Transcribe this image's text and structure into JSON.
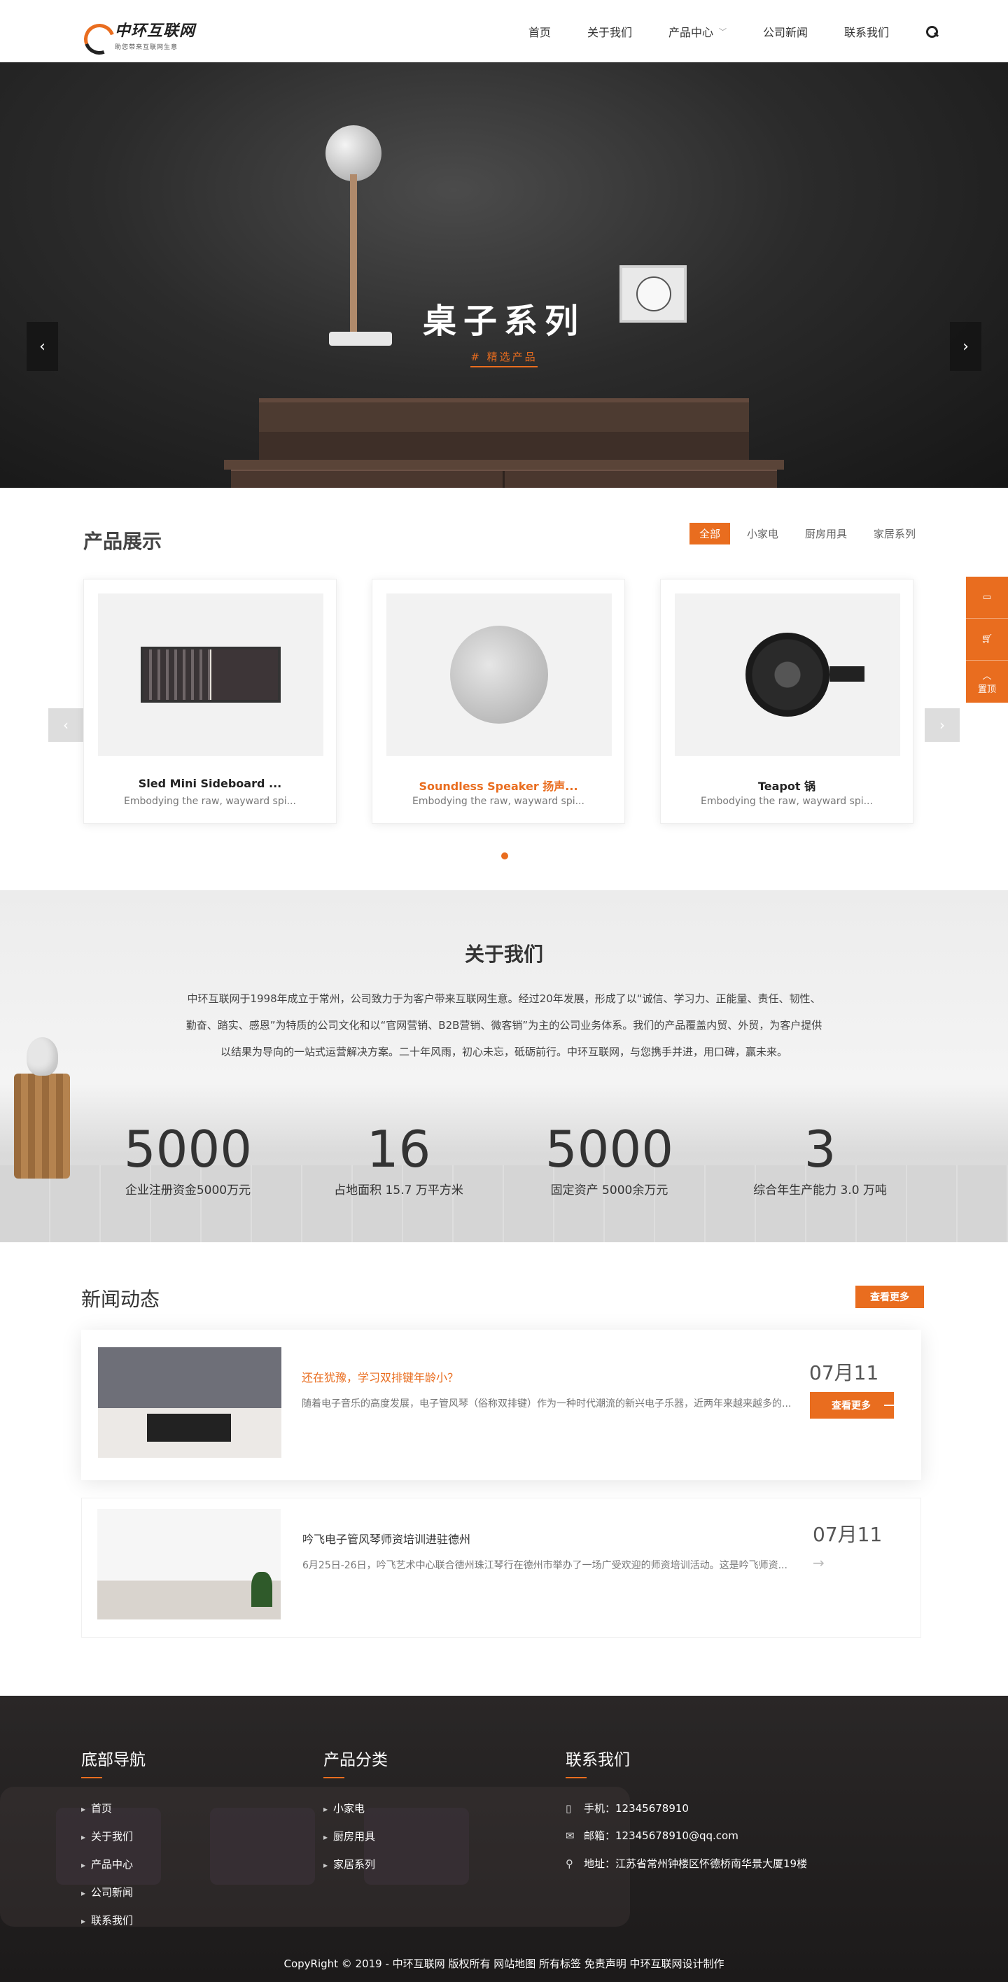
{
  "brand": {
    "name": "中环互联网",
    "slogan": "助您带来互联网生意",
    "accent_color": "#e96d1f"
  },
  "nav": {
    "items": [
      {
        "label": "首页"
      },
      {
        "label": "关于我们"
      },
      {
        "label": "产品中心"
      },
      {
        "label": "公司新闻"
      },
      {
        "label": "联系我们"
      }
    ],
    "search_icon": "search-icon",
    "dropdown_icon": "chevron-down-icon"
  },
  "banner": {
    "title": "桌子系列",
    "subtitle": "# 精选产品",
    "prev_icon": "chevron-left-icon",
    "next_icon": "chevron-right-icon"
  },
  "products": {
    "title": "产品展示",
    "tabs": [
      {
        "label": "全部",
        "active": true
      },
      {
        "label": "小家电",
        "active": false
      },
      {
        "label": "厨房用具",
        "active": false
      },
      {
        "label": "家居系列",
        "active": false
      }
    ],
    "items": [
      {
        "title": "Sled Mini Sideboard ...",
        "desc": "Embodying the raw, wayward spi..."
      },
      {
        "title": "Soundless Speaker 扬声...",
        "desc": "Embodying the raw, wayward spi..."
      },
      {
        "title": "Teapot 锅",
        "desc": "Embodying the raw, wayward spi..."
      }
    ]
  },
  "about": {
    "title": "关于我们",
    "intro": "中环互联网于1998年成立于常州，公司致力于为客户带来互联网生意。经过20年发展，形成了以“诚信、学习力、正能量、责任、韧性、勤奋、踏实、感恩”为特质的公司文化和以“官网营销、B2B营销、微客销”为主的公司业务体系。我们的产品覆盖内贸、外贸，为客户提供以结果为导向的一站式运营解决方案。二十年风雨，初心未忘，砥砺前行。中环互联网，与您携手并进，用口碑，赢未来。",
    "stats": [
      {
        "num": "5000",
        "label": "企业注册资金5000万元"
      },
      {
        "num": "16",
        "label": "占地面积 15.7 万平方米"
      },
      {
        "num": "5000",
        "label": "固定资产 5000余万元"
      },
      {
        "num": "3",
        "label": "综合年生产能力 3.0 万吨"
      }
    ]
  },
  "news": {
    "title": "新闻动态",
    "more_label": "查看更多",
    "items": [
      {
        "title": "还在犹豫，学习双排键年龄小？",
        "desc": "随着电子音乐的高度发展，电子管风琴（俗称双排键）作为一种时代潮流的新兴电子乐器，近两年来越来越多的...",
        "date": "07月11",
        "button": "查看更多"
      },
      {
        "title": "吟飞电子管风琴师资培训进驻德州",
        "desc": "6月25日-26日，吟飞艺术中心联合德州珠江琴行在德州市举办了一场广受欢迎的师资培训活动。这是吟飞师资...",
        "date": "07月11",
        "arrow": "→"
      }
    ]
  },
  "footer": {
    "nav_title": "底部导航",
    "nav_items": [
      "首页",
      "关于我们",
      "产品中心",
      "公司新闻",
      "联系我们"
    ],
    "cat_title": "产品分类",
    "cat_items": [
      "小家电",
      "厨房用具",
      "家居系列"
    ],
    "contact_title": "联系我们",
    "phone": "手机：12345678910",
    "email": "邮箱：12345678910@qq.com",
    "address": "地址：江苏省常州钟楼区怀德桥南华景大厦19楼",
    "copyright": "CopyRight © 2019 -   中环互联网  版权所有  网站地图  所有标签   免责声明   中环互联网设计制作"
  },
  "side_float": {
    "top_label": "置顶"
  }
}
